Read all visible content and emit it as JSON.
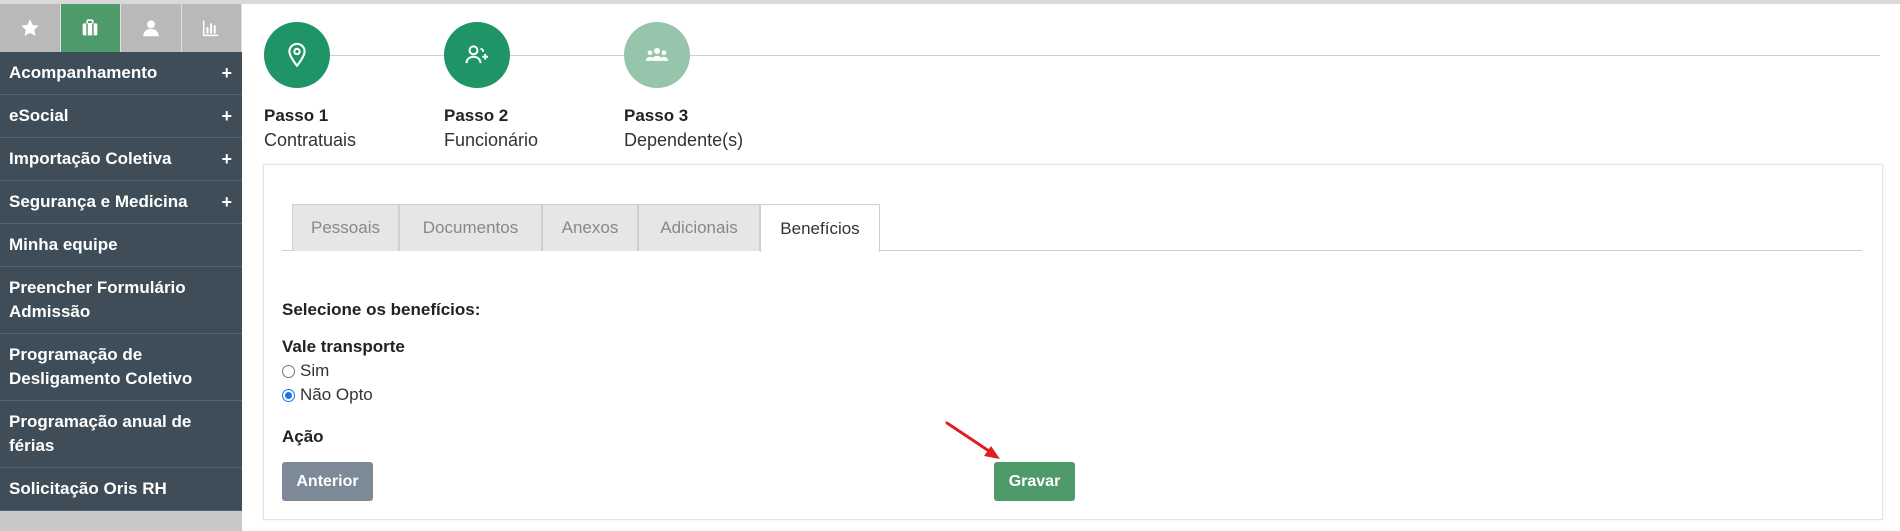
{
  "sidebar": {
    "icons": [
      {
        "name": "star-icon",
        "active": false
      },
      {
        "name": "briefcase-icon",
        "active": true
      },
      {
        "name": "user-icon",
        "active": false
      },
      {
        "name": "chart-icon",
        "active": false
      }
    ],
    "items": [
      {
        "label": "Acompanhamento",
        "expandable": "+"
      },
      {
        "label": "eSocial",
        "expandable": "+"
      },
      {
        "label": "Importação Coletiva",
        "expandable": "+"
      },
      {
        "label": "Segurança e Medicina",
        "expandable": "+"
      },
      {
        "label": "Minha equipe"
      },
      {
        "label": "Preencher Formulário Admissão"
      },
      {
        "label": "Programação de Desligamento Coletivo"
      },
      {
        "label": "Programação anual de férias"
      },
      {
        "label": "Solicitação Oris RH"
      }
    ]
  },
  "steps": [
    {
      "title": "Passo 1",
      "subtitle": "Contratuais",
      "icon": "location-pin-icon",
      "status": "complete"
    },
    {
      "title": "Passo 2",
      "subtitle": "Funcionário",
      "icon": "add-user-icon",
      "status": "complete"
    },
    {
      "title": "Passo 3",
      "subtitle": "Dependente(s)",
      "icon": "group-icon",
      "status": "pending"
    }
  ],
  "tabs": [
    {
      "label": "Pessoais"
    },
    {
      "label": "Documentos"
    },
    {
      "label": "Anexos"
    },
    {
      "label": "Adicionais"
    },
    {
      "label": "Benefícios",
      "active": true
    }
  ],
  "form": {
    "prompt": "Selecione os benefícios:",
    "vale_transporte": {
      "label": "Vale transporte",
      "options": [
        {
          "label": "Sim",
          "checked": false
        },
        {
          "label": "Não Opto",
          "checked": true
        }
      ]
    },
    "action_label": "Ação",
    "prev_button": "Anterior",
    "save_button": "Gravar"
  },
  "colors": {
    "primary_green": "#4f9a6b",
    "step_green": "#1e9467",
    "step_pending": "#96c5ac",
    "sidebar_bg": "#3e4d58",
    "annotation_arrow": "#e02020"
  }
}
